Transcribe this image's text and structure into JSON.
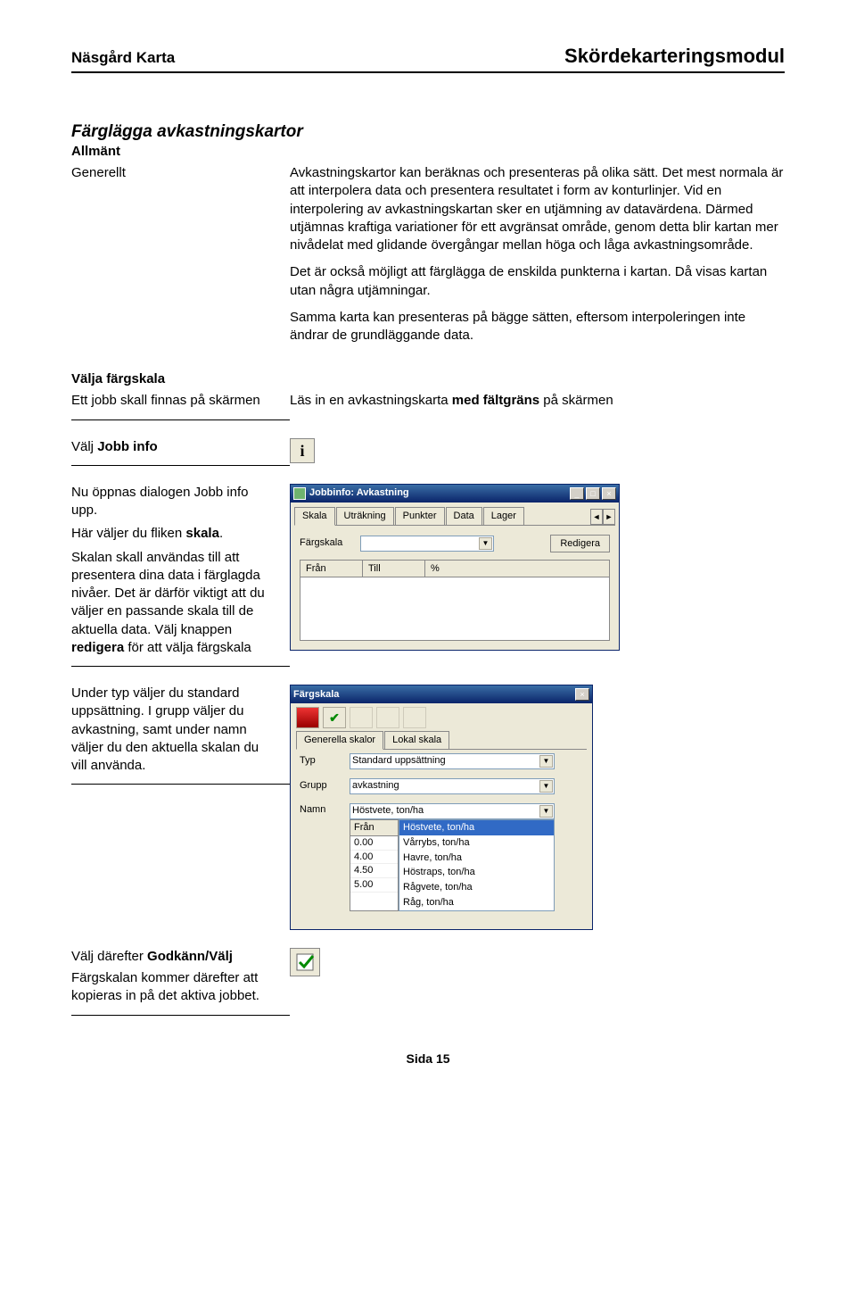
{
  "header": {
    "left": "Näsgård Karta",
    "right": "Skördekarteringsmodul"
  },
  "s1": {
    "title": "Färglägga avkastningskartor",
    "sub": "Allmänt",
    "left": "Generellt",
    "p1": "Avkastningskartor kan beräknas och presenteras på olika sätt. Det mest normala är att interpolera data och presentera resultatet i form av konturlinjer. Vid en interpolering av avkastningskartan sker en utjämning av datavärdena. Därmed utjämnas kraftiga variationer för ett avgränsat område, genom detta blir kartan mer nivådelat med glidande övergångar mellan höga och låga avkastningsområde.",
    "p2": "Det är också möjligt att färglägga de enskilda punkterna i kartan. Då visas kartan utan några utjämningar.",
    "p3": "Samma karta kan presenteras på bägge sätten, eftersom interpoleringen inte ändrar de grundläggande data."
  },
  "s2": {
    "title": "Välja färgskala",
    "left": "Ett jobb skall finnas på skärmen",
    "right_pre": "Läs in en avkastningskarta ",
    "right_bold": "med fältgräns",
    "right_post": " på skärmen"
  },
  "s3": {
    "left_pre": "Välj ",
    "left_bold": "Jobb info"
  },
  "s4": {
    "l1": "Nu öppnas dialogen Jobb info upp.",
    "l2a": "Här väljer du fliken ",
    "l2b": "skala",
    "l2c": ".",
    "l3a": "Skalan skall användas till att presentera dina data i färglagda nivåer. Det är därför viktigt att du väljer en passande skala till de aktuella data. Välj knappen ",
    "l3b": "redigera",
    "l3c": " för att välja färgskala"
  },
  "jobbinfo": {
    "title": "Jobbinfo: Avkastning",
    "tabs": [
      "Skala",
      "Uträkning",
      "Punkter",
      "Data",
      "Lager"
    ],
    "fLabel": "Färgskala",
    "fValue": "",
    "btn": "Redigera",
    "cols": [
      "Från",
      "Till",
      "%"
    ]
  },
  "s5": {
    "text": "Under typ väljer du standard uppsättning. I grupp väljer du avkastning, samt under namn väljer du den aktuella skalan du vill använda."
  },
  "fargskala": {
    "title": "Färgskala",
    "tabs": [
      "Generella skalor",
      "Lokal skala"
    ],
    "typLabel": "Typ",
    "typValue": "Standard uppsättning",
    "gruppLabel": "Grupp",
    "gruppValue": "avkastning",
    "namnLabel": "Namn",
    "namnValue": "Höstvete, ton/ha",
    "options": [
      "Höstvete, ton/ha",
      "Vårrybs, ton/ha",
      "Havre, ton/ha",
      "Höstraps, ton/ha",
      "Rågvete, ton/ha",
      "Råg, ton/ha"
    ],
    "fCol": "Från",
    "fVals": [
      "0.00",
      "4.00",
      "4.50",
      "5.00"
    ]
  },
  "s6": {
    "l1a": "Välj därefter ",
    "l1b": "Godkänn/Välj",
    "l2": "Färgskalan kommer därefter att kopieras in på det aktiva jobbet."
  },
  "footer": "Sida 15"
}
